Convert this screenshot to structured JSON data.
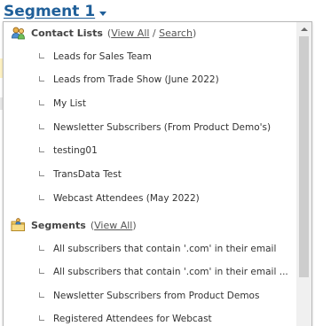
{
  "title": "Segment 1",
  "dropdown": {
    "contact_lists": {
      "title": "Contact Lists",
      "open_paren": "(",
      "view_all": "View All",
      "separator": " / ",
      "search": "Search",
      "close_paren": ")",
      "icon": "contacts-icon",
      "items": [
        "Leads for Sales Team",
        "Leads from Trade Show (June 2022)",
        "My List",
        "Newsletter Subscribers (From Product Demo's)",
        "testing01",
        "TransData Test",
        "Webcast Attendees (May 2022)"
      ]
    },
    "segments": {
      "title": "Segments",
      "open_paren": "(",
      "view_all": "View All",
      "close_paren": ")",
      "icon": "folder-user-icon",
      "items": [
        "All subscribers that contain '.com' in their email",
        "All subscribers that contain '.com' in their email ...",
        "Newsletter Subscribers from Product Demos",
        "Registered Attendees for Webcast"
      ]
    }
  },
  "colors": {
    "title": "#1f5f99",
    "scroll_thumb": "#cdcdcd",
    "scroll_track": "#f0f0f0"
  }
}
